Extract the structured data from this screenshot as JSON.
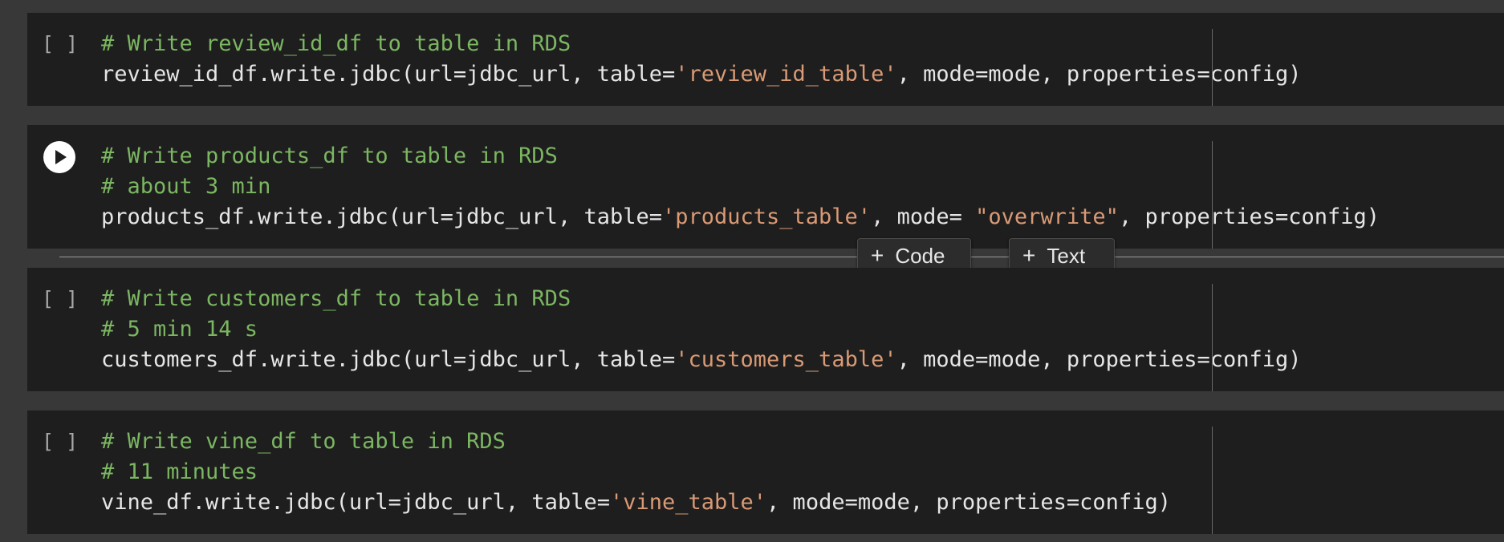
{
  "gutter_empty_label": "[ ]",
  "cells": [
    {
      "comment1": "# Write review_id_df to table in RDS",
      "code": {
        "pre": "review_id_df.write.jdbc(url=jdbc_url, table=",
        "str1": "'review_id_table'",
        "post": ", mode=mode, properties=config)"
      }
    },
    {
      "comment1": "# Write products_df to table in RDS",
      "comment2": "# about 3 min",
      "code": {
        "pre": "products_df.write.jdbc(url=jdbc_url, table=",
        "str1": "'products_table'",
        "mid": ", mode= ",
        "str2": "\"overwrite\"",
        "post": ", properties=config)"
      }
    },
    {
      "comment1": "# Write customers_df to table in RDS",
      "comment2": "# 5 min 14 s",
      "code": {
        "pre": "customers_df.write.jdbc(url=jdbc_url, table=",
        "str1": "'customers_table'",
        "post": ", mode=mode, properties=config)"
      }
    },
    {
      "comment1": "# Write vine_df to table in RDS",
      "comment2": "# 11 minutes",
      "code": {
        "pre": "vine_df.write.jdbc(url=jdbc_url, table=",
        "str1": "'vine_table'",
        "post": ", mode=mode, properties=config)"
      }
    }
  ],
  "insert_toolbar": {
    "plus_glyph": "+",
    "code_label": "Code",
    "text_label": "Text"
  },
  "colors": {
    "comment": "#7bb661",
    "string": "#d99a75",
    "code": "#e6e6e6",
    "cell_bg": "#1e1e1e",
    "page_bg": "#383838"
  },
  "icons": {
    "run": "play-circle-icon",
    "add": "plus-icon"
  }
}
